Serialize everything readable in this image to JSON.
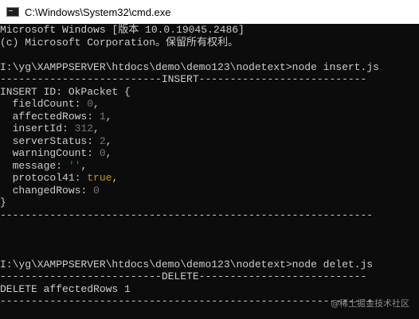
{
  "window": {
    "title": "C:\\Windows\\System32\\cmd.exe",
    "icon": "cmd-icon"
  },
  "console": {
    "lines": [
      "Microsoft Windows [版本 10.0.19045.2486]",
      "(c) Microsoft Corporation。保留所有权利。",
      "",
      "I:\\yg\\XAMPPSERVER\\htdocs\\demo\\demo123\\nodetext>node insert.js",
      "--------------------------INSERT---------------------------",
      "INSERT ID: OkPacket {",
      "  fieldCount: 0,",
      "  affectedRows: 1,",
      "  insertId: 312,",
      "  serverStatus: 2,",
      "  warningCount: 0,",
      "  message: '',",
      "  protocol41: true,",
      "  changedRows: 0",
      "}",
      "------------------------------------------------------------",
      "",
      "",
      "",
      "I:\\yg\\XAMPPSERVER\\htdocs\\demo\\demo123\\nodetext>node delet.js",
      "--------------------------DELETE---------------------------",
      "DELETE affectedRows 1",
      "------------------------------------------------------------"
    ],
    "colors": {
      "background": "#0c0c0c",
      "text": "#cccccc",
      "number": "#767676",
      "string": "#13a10e",
      "boolean": "#c19c00"
    }
  },
  "watermark": "@稀土掘金技术社区"
}
